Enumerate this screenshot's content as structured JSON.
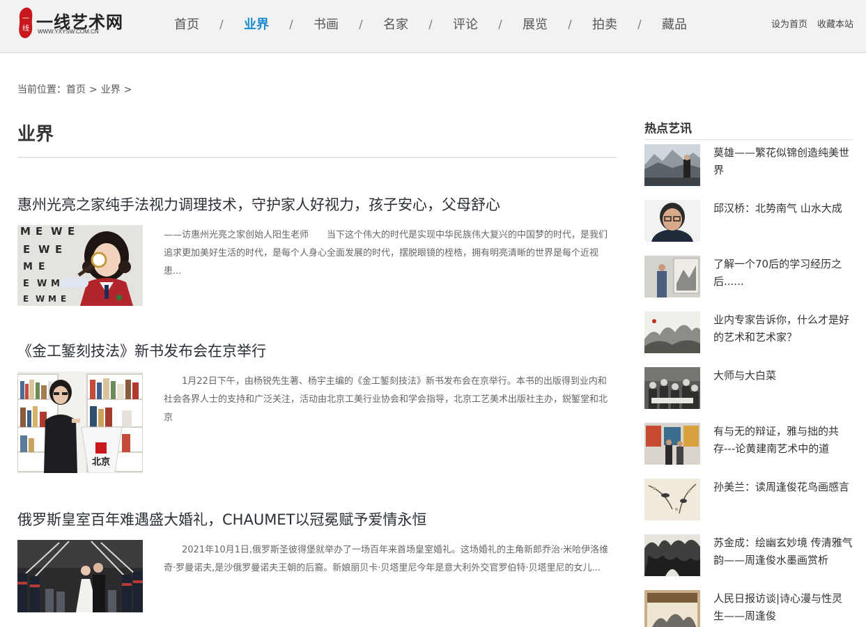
{
  "site": {
    "logo_title": "一线艺术网",
    "logo_url": "WWW.YXYSW.COM.CN",
    "logo_seal_text": "一线"
  },
  "nav": [
    {
      "label": "首页",
      "active": false
    },
    {
      "label": "业界",
      "active": true
    },
    {
      "label": "书画",
      "active": false
    },
    {
      "label": "名家",
      "active": false
    },
    {
      "label": "评论",
      "active": false
    },
    {
      "label": "展览",
      "active": false
    },
    {
      "label": "拍卖",
      "active": false
    },
    {
      "label": "藏品",
      "active": false
    }
  ],
  "nav_separator": "/",
  "toplinks": {
    "set_home": "设为首页",
    "bookmark": "收藏本站"
  },
  "breadcrumb": {
    "prefix": "当前位置：",
    "items": [
      "首页",
      "业界"
    ],
    "separator": ">"
  },
  "page_title": "业界",
  "articles": [
    {
      "title": "惠州光亮之家纯手法视力调理技术，守护家人好视力，孩子安心，父母舒心",
      "excerpt": "——访惠州光亮之家创始人阳生老师　　当下这个伟大的时代是实现中华民族伟大复兴的中国梦的时代，是我们追求更加美好生活的时代，是每个人身心全面发展的时代，摆脱眼镜的桎梏，拥有明亮清晰的世界是每个近视患..."
    },
    {
      "title": "《金工錾刻技法》新书发布会在京举行",
      "excerpt": "　　1月22日下午，由杨锐先生著、杨宇主编的《金工錾刻技法》新书发布会在京举行。本书的出版得到业内和社会各界人士的支持和广泛关注，活动由北京工美行业协会和学会指导，北京工艺美术出版社主办，鋭錾堂和北京",
      "podium_text": "北京"
    },
    {
      "title": "俄罗斯皇室百年难遇盛大婚礼，CHAUMET以冠冕赋予爱情永恒",
      "excerpt": "　　2021年10月1日,俄罗斯圣彼得堡就举办了一场百年来首场皇室婚礼。这场婚礼的主角新郎乔治·米哈伊洛维奇·罗曼诺夫,是沙俄罗曼诺夫王朝的后裔。新娘丽贝卡·贝塔里尼今年是意大利外交官罗伯特·贝塔里尼的女儿..."
    }
  ],
  "eye_chart_letters": [
    "M",
    "E",
    "W",
    "E",
    "E",
    "W",
    "E",
    "M",
    "E",
    "E",
    "W",
    "M",
    "E",
    "W",
    "M",
    "E"
  ],
  "sidebar": {
    "heading": "热点艺讯",
    "items": [
      {
        "title": "莫雄——繁花似锦创造纯美世界",
        "thumb": "mountain-landscape"
      },
      {
        "title": "邱汉桥：北势南气 山水大成",
        "thumb": "portrait-glasses"
      },
      {
        "title": "了解一个70后的学习经历之后......",
        "thumb": "man-with-painting"
      },
      {
        "title": "业内专家告诉你，什么才是好的艺术和艺术家？",
        "thumb": "ink-landscape"
      },
      {
        "title": "大师与大白菜",
        "thumb": "group-photo"
      },
      {
        "title": "有与无的辩证，雅与拙的共存---论黄建南艺术中的道",
        "thumb": "exhibition-photo"
      },
      {
        "title": "孙美兰：读周逢俊花鸟画感言",
        "thumb": "bird-painting"
      },
      {
        "title": "苏金成：绘幽玄妙境 传清雅气韵——周逢俊水墨画赏析",
        "thumb": "ink-mountains"
      },
      {
        "title": "人民日报访谈|诗心漫与性灵生——周逢俊",
        "thumb": "book-cover"
      }
    ]
  },
  "colors": {
    "header_bg": "#f2f2f2",
    "nav_active": "#1a8ccf",
    "logo_red": "#c8181e"
  }
}
